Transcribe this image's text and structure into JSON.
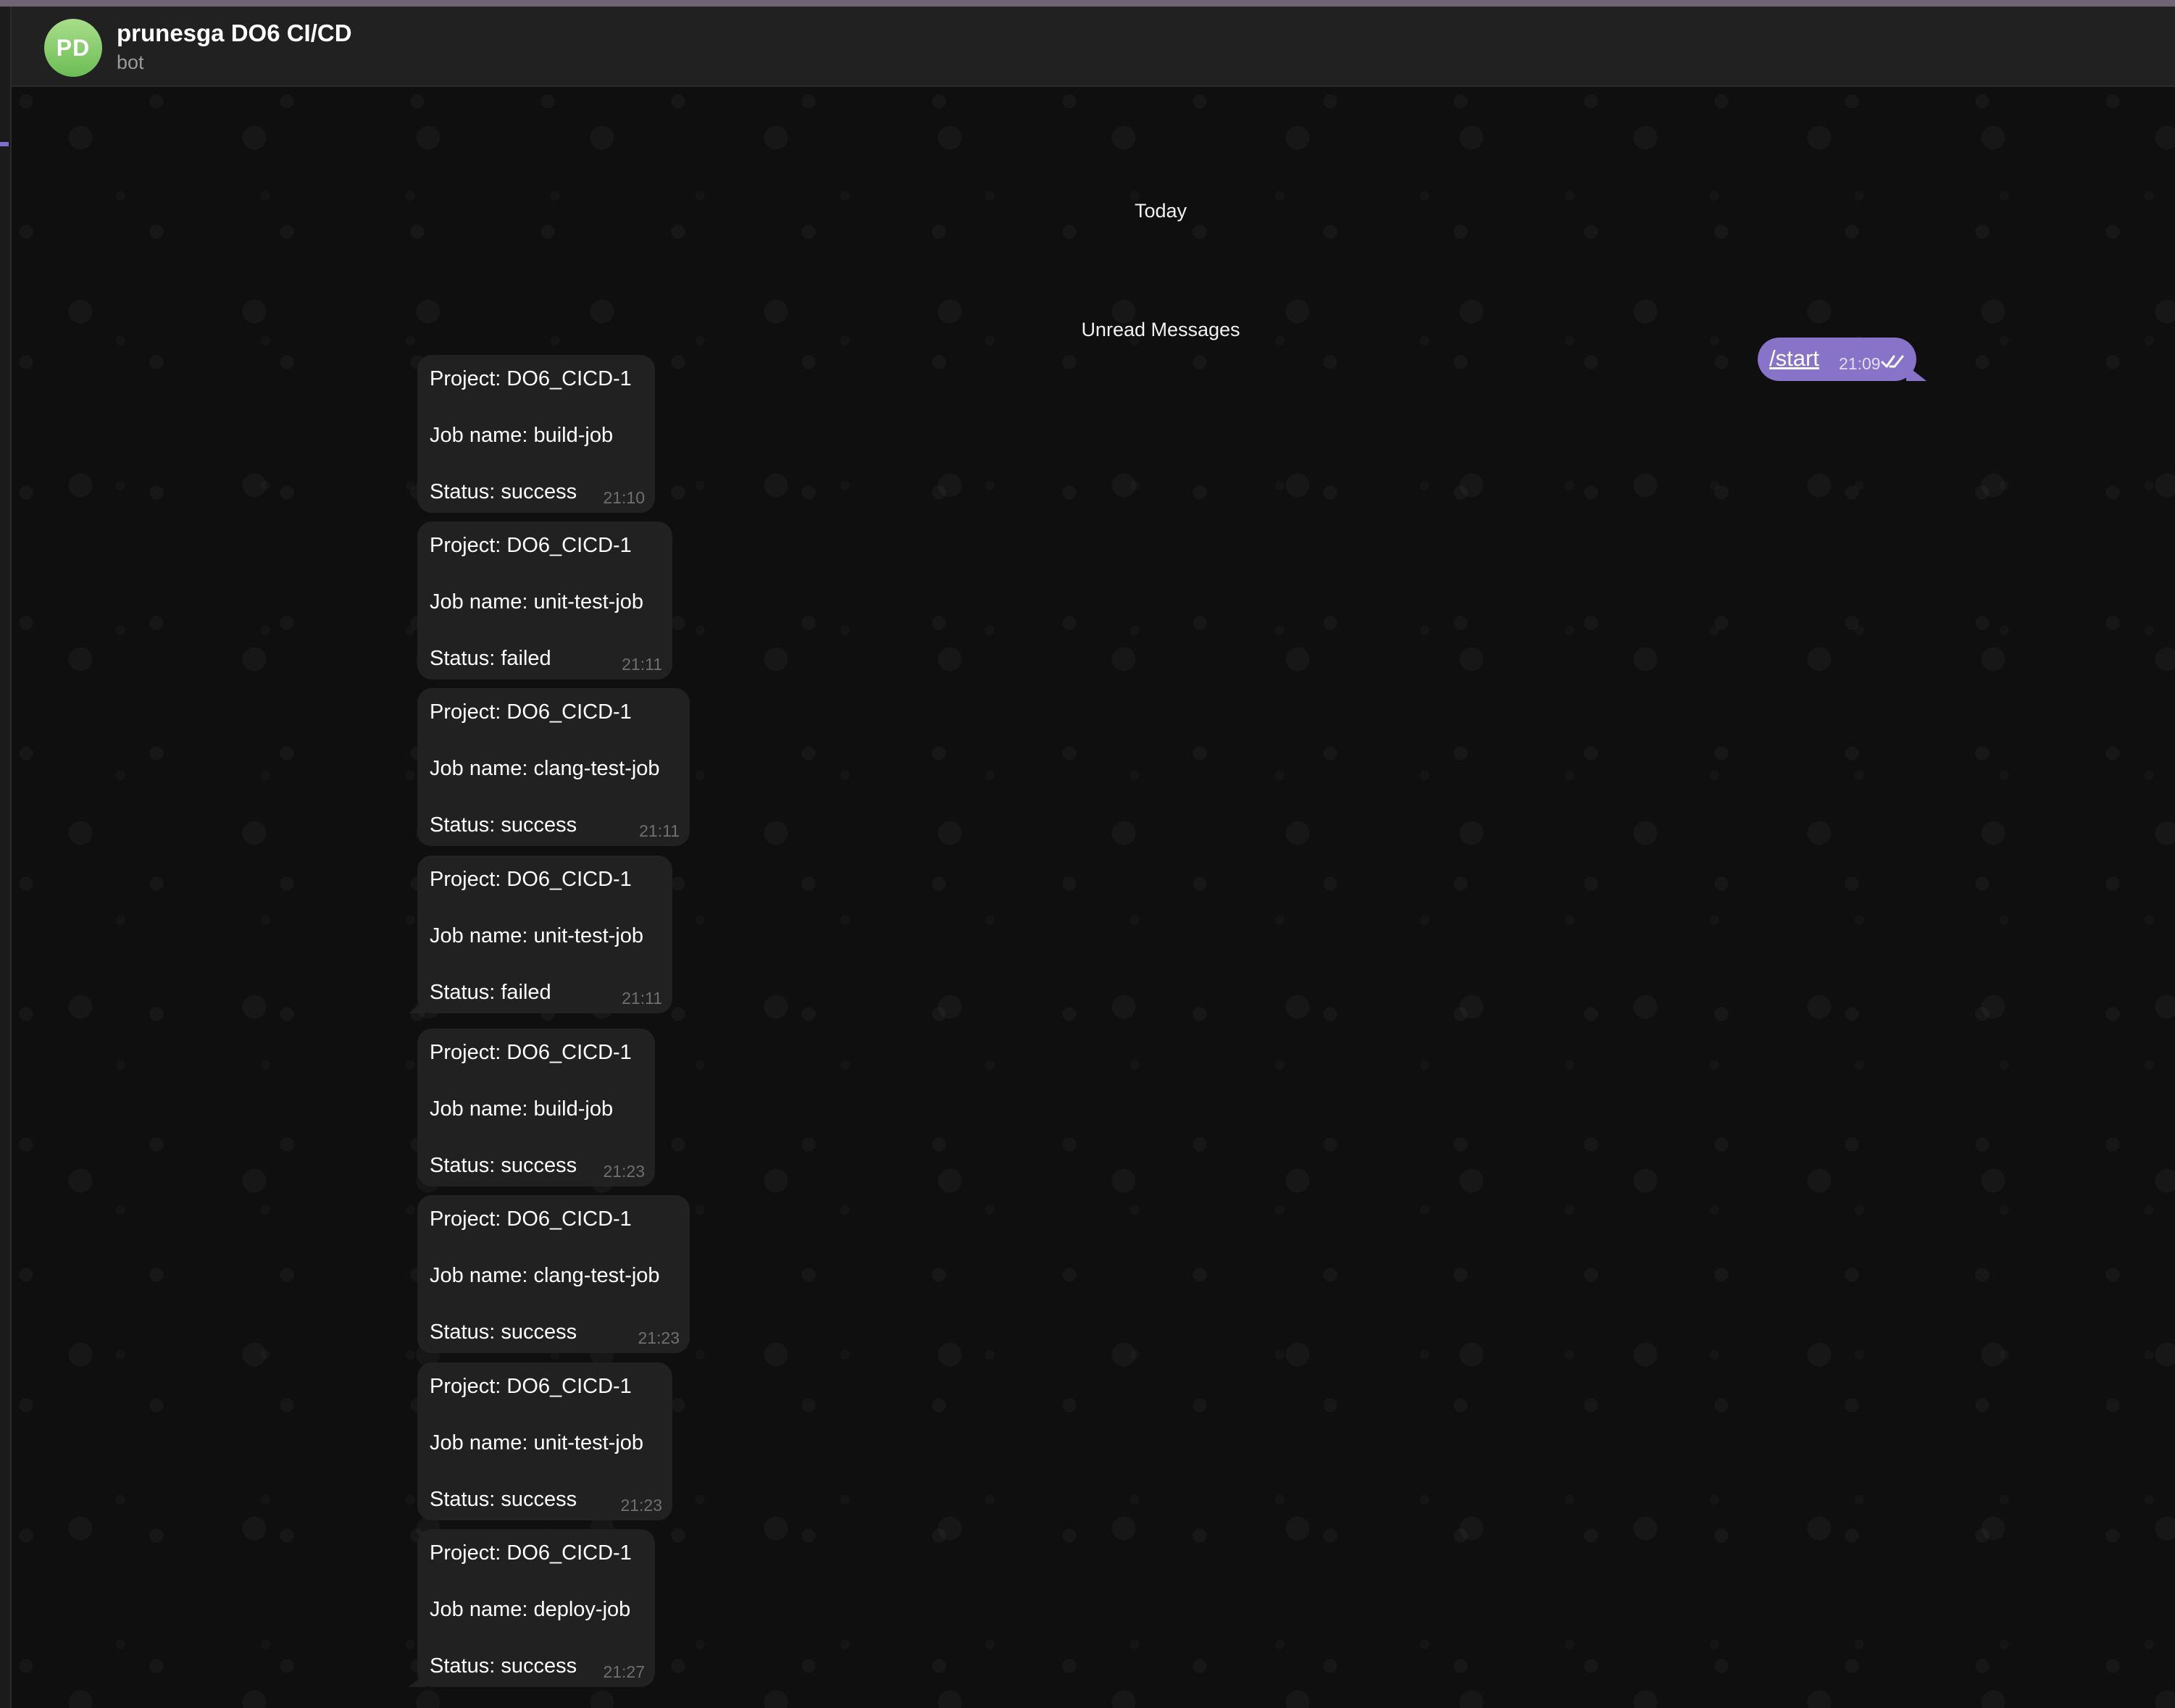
{
  "window": {
    "accent_color": "#8774c8",
    "incoming_bubble_color": "#212121"
  },
  "header": {
    "avatar_initials": "PD",
    "title": "prunesga DO6 CI/CD",
    "subtitle": "bot"
  },
  "chat": {
    "date_label": "Today",
    "unread_label": "Unread Messages",
    "outgoing": {
      "text": "/start",
      "time": "21:09"
    },
    "messages": [
      {
        "project": "Project: DO6_CICD-1",
        "job": "Job name: build-job",
        "status": "Status: success",
        "time": "21:10"
      },
      {
        "project": "Project: DO6_CICD-1",
        "job": "Job name: unit-test-job",
        "status": "Status: failed",
        "time": "21:11"
      },
      {
        "project": "Project: DO6_CICD-1",
        "job": "Job name: clang-test-job",
        "status": "Status: success",
        "time": "21:11"
      },
      {
        "project": "Project: DO6_CICD-1",
        "job": "Job name: unit-test-job",
        "status": "Status: failed",
        "time": "21:11"
      },
      {
        "project": "Project: DO6_CICD-1",
        "job": "Job name: build-job",
        "status": "Status: success",
        "time": "21:23"
      },
      {
        "project": "Project: DO6_CICD-1",
        "job": "Job name: clang-test-job",
        "status": "Status: success",
        "time": "21:23"
      },
      {
        "project": "Project: DO6_CICD-1",
        "job": "Job name: unit-test-job",
        "status": "Status: success",
        "time": "21:23"
      },
      {
        "project": "Project: DO6_CICD-1",
        "job": "Job name: deploy-job",
        "status": "Status: success",
        "time": "21:27"
      }
    ]
  }
}
